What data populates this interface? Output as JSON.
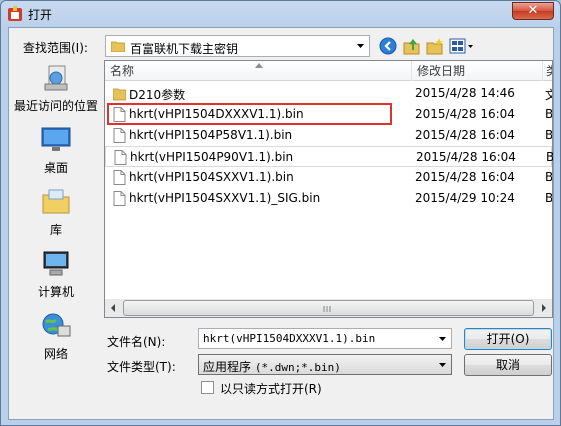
{
  "window": {
    "title": "打开",
    "close_glyph": "✕"
  },
  "toolbar": {
    "look_in_label": "查找范围(I):",
    "look_in_value": "百富联机下载主密钥",
    "icons": [
      "back-icon",
      "up-folder-icon",
      "new-folder-icon",
      "view-menu-icon"
    ]
  },
  "places": [
    {
      "label": "最近访问的位置",
      "icon": "recent-places-icon"
    },
    {
      "label": "桌面",
      "icon": "desktop-icon"
    },
    {
      "label": "库",
      "icon": "libraries-icon"
    },
    {
      "label": "计算机",
      "icon": "computer-icon"
    },
    {
      "label": "网络",
      "icon": "network-icon"
    }
  ],
  "file_list": {
    "columns": {
      "name": "名称",
      "date": "修改日期",
      "more": "类"
    },
    "rows": [
      {
        "name": "D210参数",
        "date": "2015/4/28 14:46",
        "type_cut": "文",
        "kind": "folder"
      },
      {
        "name": "hkrt(vHPI1504DXXXV1.1).bin",
        "date": "2015/4/28 16:04",
        "type_cut": "B",
        "kind": "file"
      },
      {
        "name": "hkrt(vHPI1504P58V1.1).bin",
        "date": "2015/4/28 16:04",
        "type_cut": "B",
        "kind": "file"
      },
      {
        "name": "hkrt(vHPI1504P90V1.1).bin",
        "date": "2015/4/28 16:04",
        "type_cut": "B",
        "kind": "file"
      },
      {
        "name": "hkrt(vHPI1504SXXV1.1).bin",
        "date": "2015/4/28 16:04",
        "type_cut": "B",
        "kind": "file"
      },
      {
        "name": "hkrt(vHPI1504SXXV1.1)_SIG.bin",
        "date": "2015/4/29 10:24",
        "type_cut": "B",
        "kind": "file"
      }
    ],
    "highlight_color": "#e0312e"
  },
  "form": {
    "filename_label": "文件名(N):",
    "filename_value": "hkrt(vHPI1504DXXXV1.1).bin",
    "filetype_label": "文件类型(T):",
    "filetype_value_prefix": "应用程序 ",
    "filetype_value_mono": "(*.dwn;*.bin)",
    "readonly_label": "以只读方式打开(R)",
    "readonly_checked": false
  },
  "buttons": {
    "open": "打开(O)",
    "cancel": "取消"
  }
}
